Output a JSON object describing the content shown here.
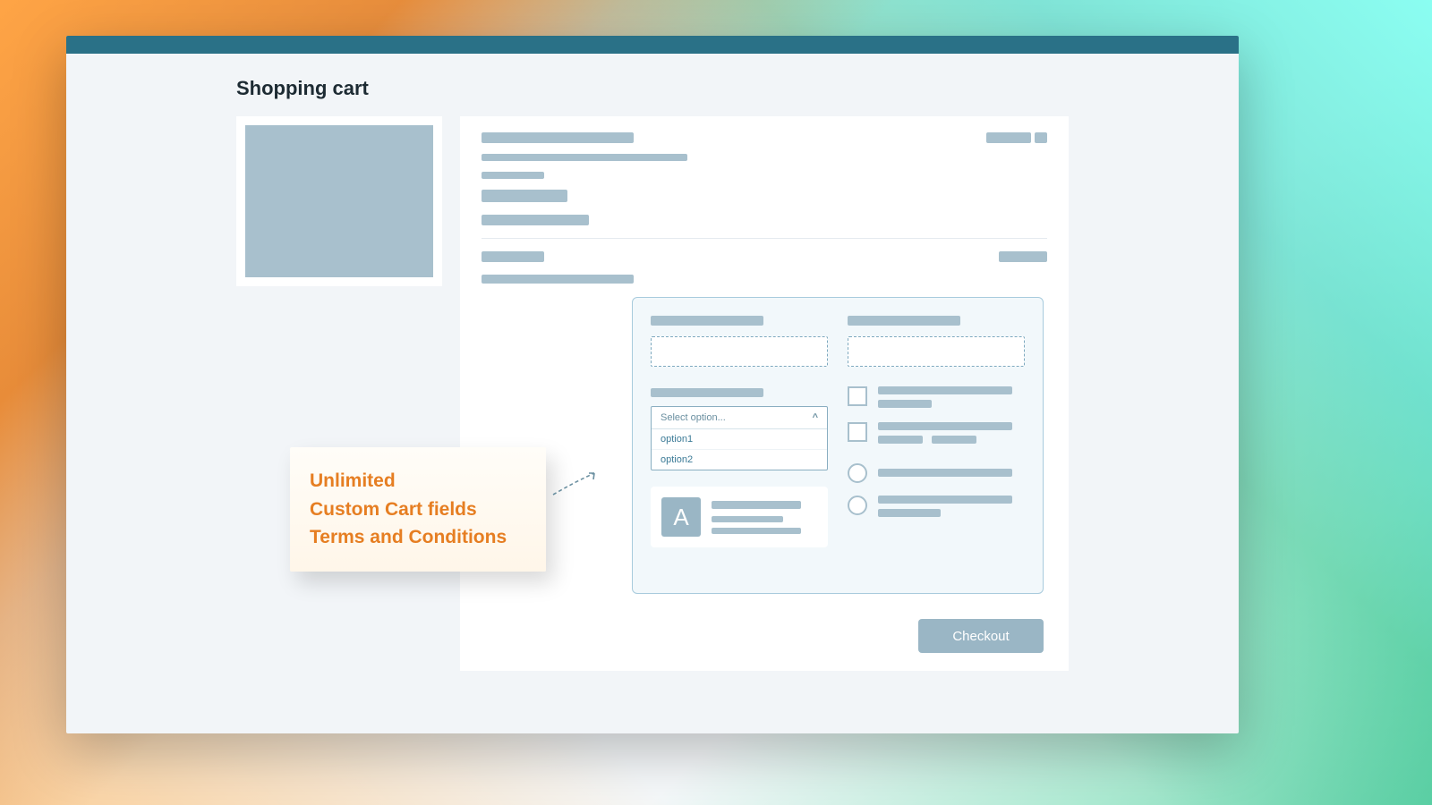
{
  "page": {
    "title": "Shopping cart"
  },
  "callout": {
    "line1": "Unlimited",
    "line2": "Custom Cart fields",
    "line3": "Terms and Conditions"
  },
  "select": {
    "placeholder": "Select option...",
    "options": [
      "option1",
      "option2"
    ]
  },
  "upload": {
    "icon_letter": "A"
  },
  "checkout": {
    "label": "Checkout"
  }
}
